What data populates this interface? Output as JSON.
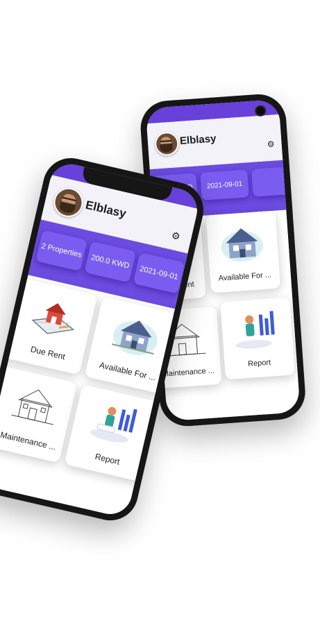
{
  "phones": [
    {
      "id": "back",
      "user_name": "Elblasy",
      "stats": [
        {
          "label": "2 Properties",
          "visible": false
        },
        {
          "label": "200.0 KWD",
          "visible": true
        },
        {
          "label": "2021-09-01",
          "visible": true
        }
      ],
      "cards": [
        {
          "label": "Due Rent",
          "icon": "house-tools-icon"
        },
        {
          "label": "Available For ...",
          "icon": "house-icon"
        },
        {
          "label": "Maintenance ...",
          "icon": "house-sketch-icon"
        },
        {
          "label": "Report",
          "icon": "report-chart-icon"
        }
      ]
    },
    {
      "id": "front",
      "user_name": "Elblasy",
      "stats": [
        {
          "label": "2 Properties",
          "visible": true
        },
        {
          "label": "200.0 KWD",
          "visible": true
        },
        {
          "label": "2021-09-01",
          "visible": true
        }
      ],
      "cards": [
        {
          "label": "Due Rent",
          "icon": "house-tools-icon"
        },
        {
          "label": "Available For ...",
          "icon": "house-icon"
        },
        {
          "label": "Maintenance ...",
          "icon": "house-sketch-icon"
        },
        {
          "label": "Report",
          "icon": "report-chart-icon"
        }
      ]
    }
  ],
  "colors": {
    "primary": "#6741d9",
    "stats_background": "#6b4be0",
    "stat_card": "#7a5cf0",
    "header_background": "#f3f2f8"
  }
}
